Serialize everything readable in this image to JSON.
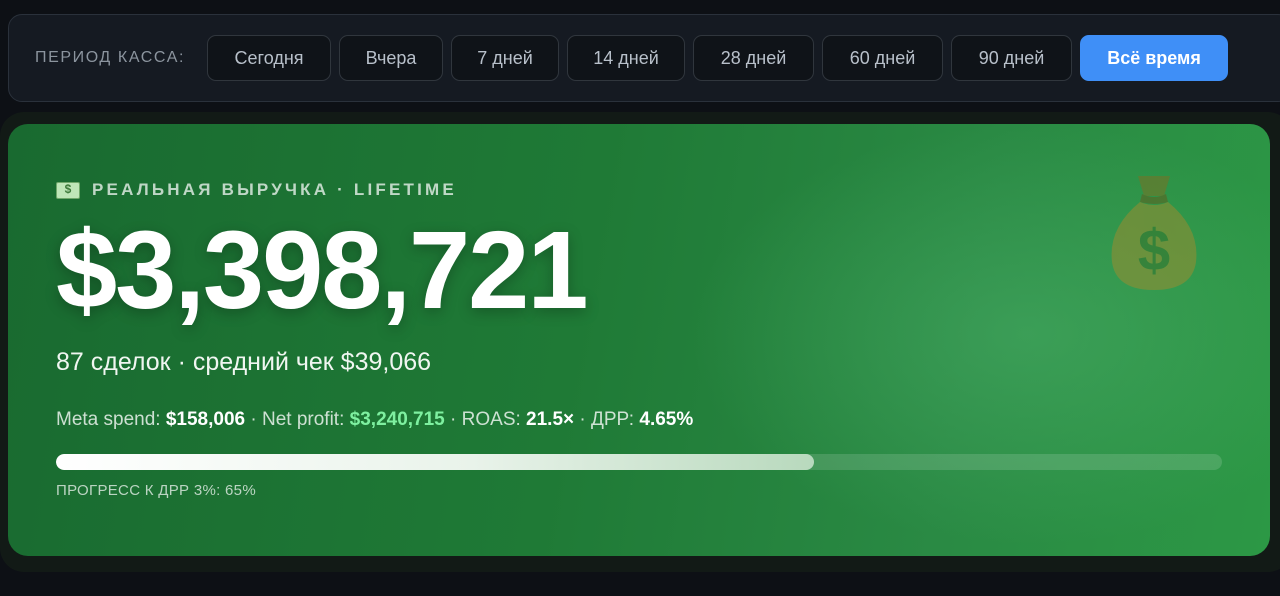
{
  "period": {
    "label": "ПЕРИОД КАССА:",
    "options": [
      {
        "label": "Сегодня",
        "active": false
      },
      {
        "label": "Вчера",
        "active": false
      },
      {
        "label": "7 дней",
        "active": false
      },
      {
        "label": "14 дней",
        "active": false
      },
      {
        "label": "28 дней",
        "active": false
      },
      {
        "label": "60 дней",
        "active": false
      },
      {
        "label": "90 дней",
        "active": false
      },
      {
        "label": "Всё время",
        "active": true
      }
    ]
  },
  "revenue": {
    "title_icon": "dollar-bill-icon",
    "title": "РЕАЛЬНАЯ ВЫРУЧКА · LIFETIME",
    "value": "$3,398,721",
    "deals_line": "87 сделок · средний чек $39,066",
    "meta_spend_label": "Meta spend:",
    "meta_spend_value": "$158,006",
    "net_profit_label": "Net profit:",
    "net_profit_value": "$3,240,715",
    "roas_label": "ROAS:",
    "roas_value": "21.5×",
    "drr_label": "ДРР:",
    "drr_value": "4.65%",
    "separator": "·",
    "progress_percent": 65,
    "progress_label": "ПРОГРЕСС К ДРР 3%: 65%",
    "decor_icon": "money-bag-icon"
  },
  "colors": {
    "accent": "#3f8ff7",
    "card_green": "#1f7a36",
    "profit_green": "#7ef0a0"
  }
}
